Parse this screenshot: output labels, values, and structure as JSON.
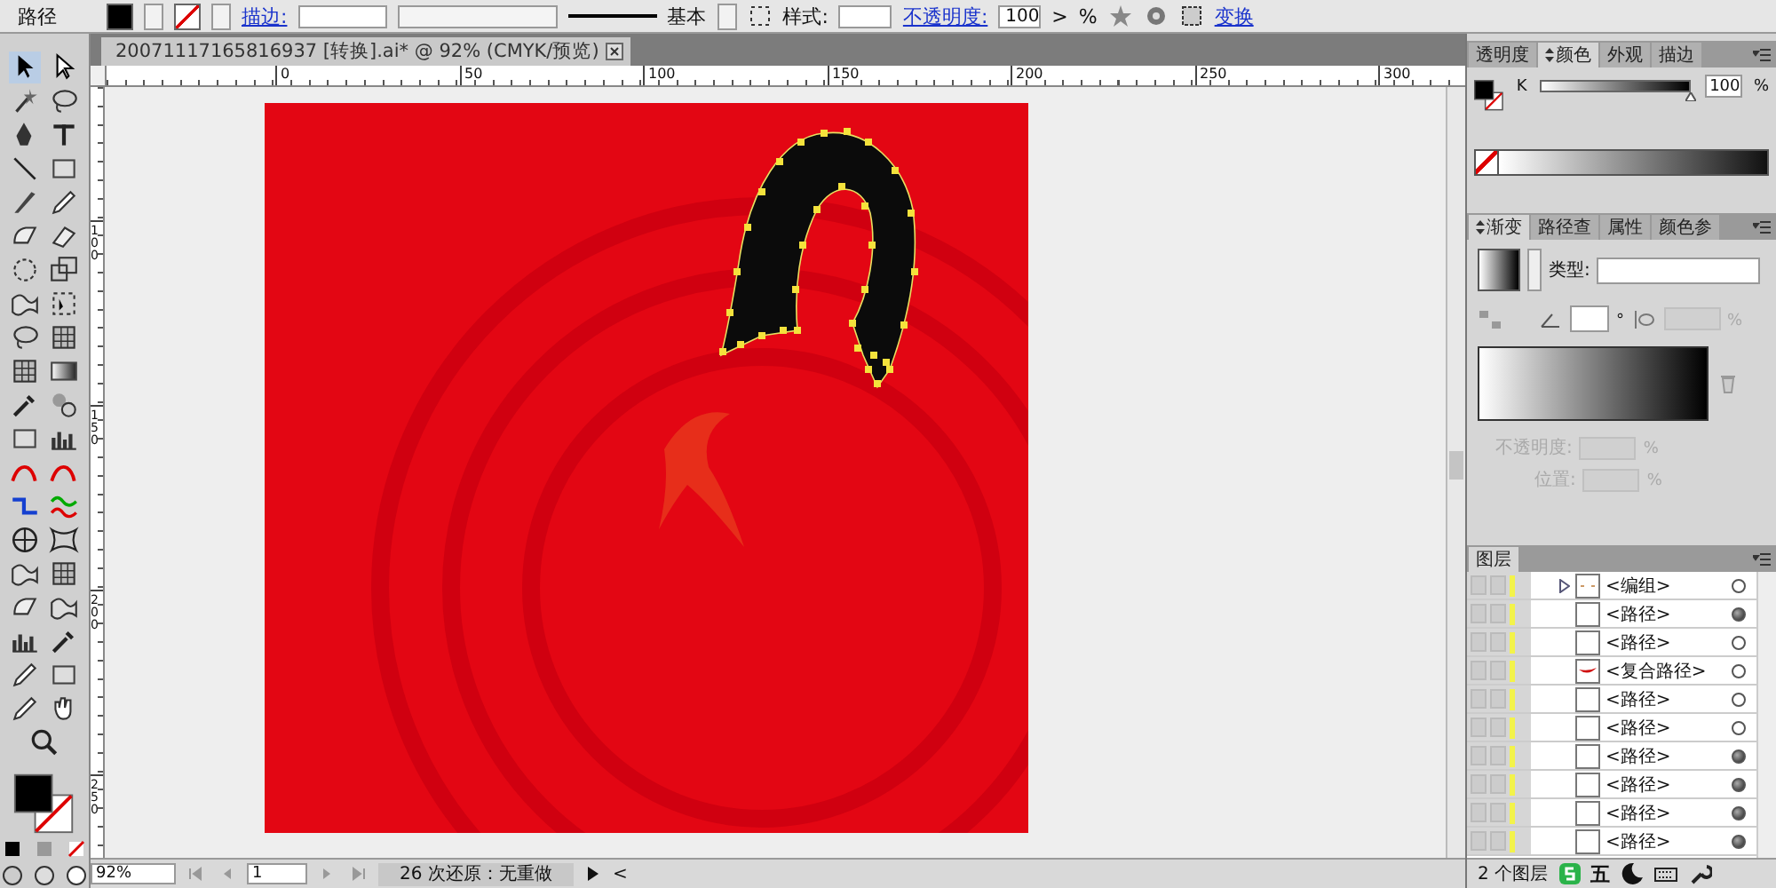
{
  "control_bar": {
    "object_type": "路径",
    "stroke_label": "描边:",
    "stroke_style": "基本",
    "style_label": "样式:",
    "opacity_label": "不透明度:",
    "opacity_value": "100",
    "opacity_arrow": ">",
    "opacity_unit": "%",
    "transform_link": "变换"
  },
  "document_tab": {
    "title": "20071117165816937 [转换].ai* @ 92% (CMYK/预览)"
  },
  "ruler": {
    "horizontal": [
      "0",
      "50",
      "100",
      "150",
      "200",
      "250",
      "300"
    ],
    "vertical": [
      "100",
      "150",
      "200",
      "250"
    ]
  },
  "color_panel": {
    "tabs": [
      {
        "label": "透明度",
        "selected": false
      },
      {
        "label": "颜色",
        "selected": true
      },
      {
        "label": "外观",
        "selected": false
      },
      {
        "label": "描边",
        "selected": false
      }
    ],
    "channel": {
      "name": "K",
      "level": 1,
      "value": "100",
      "unit": "%"
    }
  },
  "gradient_panel": {
    "tabs": [
      {
        "label": "渐变",
        "selected": true
      },
      {
        "label": "路径查",
        "selected": false
      },
      {
        "label": "属性",
        "selected": false
      },
      {
        "label": "颜色参",
        "selected": false
      }
    ],
    "type_label": "类型:",
    "angle_unit": "°",
    "aspect_unit": "%",
    "opacity_label": "不透明度:",
    "opacity_unit": "%",
    "location_label": "位置:",
    "location_unit": "%"
  },
  "layers_panel": {
    "tab": "图层",
    "rows": [
      {
        "name": "<编组>",
        "kind": "group",
        "targeted": false
      },
      {
        "name": "<路径>",
        "kind": "path",
        "targeted": true
      },
      {
        "name": "<路径>",
        "kind": "path",
        "targeted": false
      },
      {
        "name": "<复合路径>",
        "kind": "compound",
        "targeted": false
      },
      {
        "name": "<路径>",
        "kind": "path",
        "targeted": false
      },
      {
        "name": "<路径>",
        "kind": "path",
        "targeted": false
      },
      {
        "name": "<路径>",
        "kind": "path",
        "targeted": true
      },
      {
        "name": "<路径>",
        "kind": "path",
        "targeted": true
      },
      {
        "name": "<路径>",
        "kind": "path",
        "targeted": true
      },
      {
        "name": "<路径>",
        "kind": "path",
        "targeted": true
      }
    ],
    "footer": "2 个图层"
  },
  "ime_bar": {
    "mode": "五"
  },
  "status_bar": {
    "zoom": "92%",
    "page": "1",
    "status": "26 次还原：无重做",
    "scroll_arrow": "<"
  }
}
